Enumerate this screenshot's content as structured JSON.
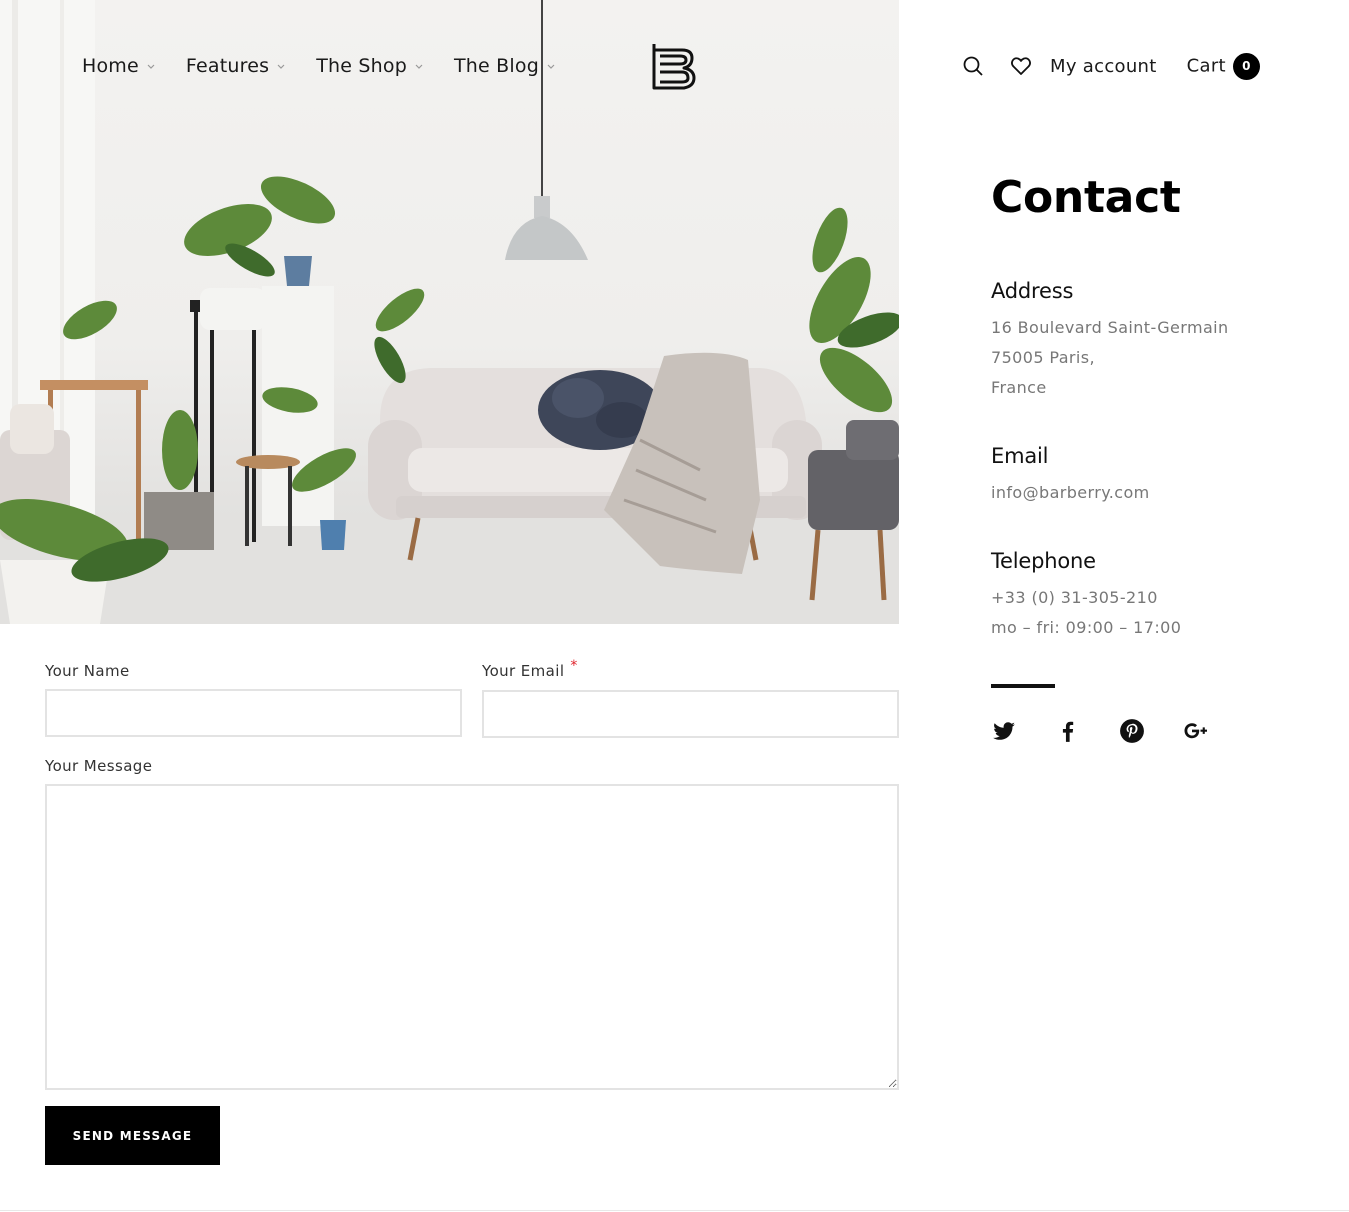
{
  "nav": {
    "items": [
      {
        "label": "Home"
      },
      {
        "label": "Features"
      },
      {
        "label": "The Shop"
      },
      {
        "label": "The Blog"
      }
    ]
  },
  "header": {
    "account_label": "My account",
    "cart_label": "Cart",
    "cart_count": "0",
    "icons": [
      "search-icon",
      "heart-icon",
      "brand-logo"
    ]
  },
  "contact": {
    "title": "Contact",
    "address": {
      "heading": "Address",
      "lines": [
        "16 Boulevard Saint-Germain",
        "75005 Paris,",
        "France"
      ]
    },
    "email": {
      "heading": "Email",
      "value": "info@barberry.com"
    },
    "telephone": {
      "heading": "Telephone",
      "lines": [
        "+33 (0) 31-305-210",
        "mo – fri: 09:00 – 17:00"
      ]
    },
    "social": [
      "twitter-icon",
      "facebook-icon",
      "pinterest-icon",
      "google-plus-icon"
    ]
  },
  "form": {
    "name_label": "Your Name",
    "name_value": "",
    "email_label": "Your Email",
    "email_required_mark": "*",
    "email_value": "",
    "message_label": "Your Message",
    "message_value": "",
    "submit_label": "SEND MESSAGE"
  },
  "colors": {
    "text": "#111111",
    "muted": "#777777",
    "button_bg": "#000000",
    "required": "#e0222b",
    "input_border": "#e3e3e3"
  }
}
